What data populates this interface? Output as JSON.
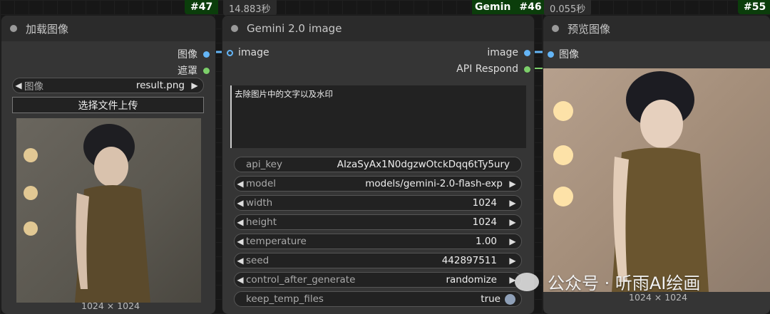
{
  "nodes": {
    "load_image": {
      "id_tag": "#47",
      "title": "加载图像",
      "outputs": [
        "图像",
        "遮罩"
      ],
      "image_widget": {
        "label": "图像",
        "value": "result.png"
      },
      "upload_label": "选择文件上传",
      "dims": "1024 × 1024"
    },
    "gemini": {
      "time": "14.883秒",
      "tag_text": "Gemin",
      "id_tag": "#46",
      "title": "Gemini 2.0 image",
      "input": "image",
      "outputs": [
        "image",
        "API Respond"
      ],
      "prompt": "去除图片中的文字以及水印",
      "widgets": [
        {
          "label": "api_key",
          "value": "AIzaSyAx1N0dgzwOtckDqq6tTy5ury"
        },
        {
          "label": "model",
          "value": "models/gemini-2.0-flash-exp"
        },
        {
          "label": "width",
          "value": "1024"
        },
        {
          "label": "height",
          "value": "1024"
        },
        {
          "label": "temperature",
          "value": "1.00"
        },
        {
          "label": "seed",
          "value": "442897511"
        },
        {
          "label": "control_after_generate",
          "value": "randomize"
        },
        {
          "label": "keep_temp_files",
          "value": "true"
        }
      ]
    },
    "preview": {
      "time": "0.055秒",
      "id_tag": "#55",
      "title": "预览图像",
      "input": "图像",
      "dims": "1024 × 1024"
    }
  },
  "watermark": "公众号 · 听雨AI绘画",
  "colors": {
    "tag_green": "#0b3d0b",
    "socket_blue": "#64b5f6",
    "socket_green": "#7ccf6a"
  }
}
